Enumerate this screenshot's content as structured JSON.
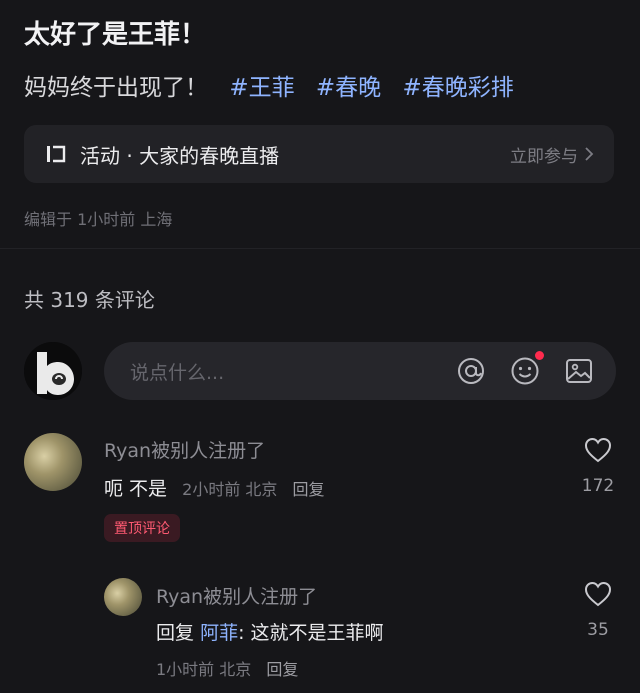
{
  "post": {
    "title": "太好了是王菲！",
    "text": "妈妈终于出现了！",
    "tags": [
      "#王菲",
      "#春晚",
      "#春晚彩排"
    ],
    "activity": {
      "label": "活动 · 大家的春晚直播",
      "join_label": "立即参与"
    },
    "meta": "编辑于 1小时前 上海"
  },
  "comments_section": {
    "count_label": "共 319 条评论",
    "input_placeholder": "说点什么...",
    "icons": [
      "at-icon",
      "emoji-icon",
      "image-icon"
    ],
    "comments": [
      {
        "user": "Ryan被别人注册了",
        "text": "呃 不是",
        "time": "2小时前",
        "location": "北京",
        "reply_label": "回复",
        "likes": "172",
        "badge": "置顶评论",
        "replies": [
          {
            "user": "Ryan被别人注册了",
            "reply_prefix": "回复",
            "reply_to": "阿菲",
            "text": ": 这就不是王菲啊",
            "time": "1小时前",
            "location": "北京",
            "reply_label": "回复",
            "likes": "35"
          }
        ]
      }
    ]
  },
  "colors": {
    "background": "#161619",
    "tag": "#8fb4ff",
    "pin_badge": "#ff5a72",
    "notification_dot": "#ff2b4e"
  }
}
